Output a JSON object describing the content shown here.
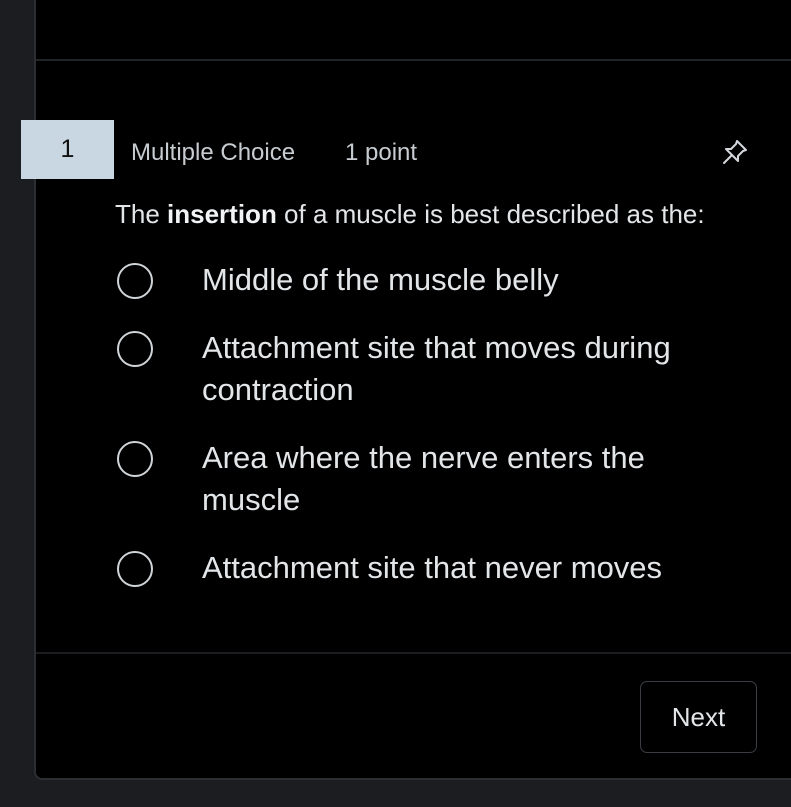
{
  "question": {
    "number": "1",
    "type": "Multiple Choice",
    "points": "1 point",
    "prompt_before": "The ",
    "prompt_bold": "insertion",
    "prompt_after": " of a muscle is best described as the:",
    "options": [
      {
        "label": "Middle of the muscle belly"
      },
      {
        "label": "Attachment site that moves during contraction"
      },
      {
        "label": "Area where the nerve enters the muscle"
      },
      {
        "label": "Attachment site that never moves"
      }
    ]
  },
  "footer": {
    "next_label": "Next"
  },
  "colors": {
    "background": "#000000",
    "question_number_bg": "#c9d7e2",
    "text": "#e3e6e9"
  },
  "icons": {
    "pin": "pin-icon",
    "radio": "radio-unselected-icon"
  }
}
